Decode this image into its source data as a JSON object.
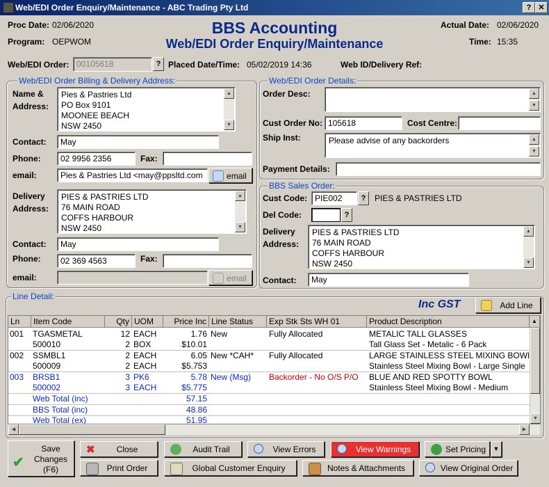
{
  "window": {
    "title": "Web/EDI Order Enquiry/Maintenance - ABC Trading Pty Ltd",
    "help": "?",
    "close": "✕"
  },
  "header": {
    "proc_date_label": "Proc Date:",
    "proc_date": "02/06/2020",
    "program_label": "Program:",
    "program": "OEPWOM",
    "app_title": "BBS Accounting",
    "screen_title": "Web/EDI Order Enquiry/Maintenance",
    "actual_date_label": "Actual Date:",
    "actual_date": "02/06/2020",
    "time_label": "Time:",
    "time": "15:35"
  },
  "order": {
    "label": "Web/EDI Order:",
    "value": "00105618",
    "lookup": "?",
    "placed_label": "Placed Date/Time:",
    "placed": "05/02/2019 14:36",
    "webid_label": "Web ID/Delivery Ref:"
  },
  "billing": {
    "group_title": "Web/EDI Order Billing & Delivery Address:",
    "name_label": "Name &",
    "address_label": "Address:",
    "name_address": [
      "Pies & Pastries Ltd",
      "PO Box 9101",
      "MOONEE BEACH",
      "NSW 2450"
    ],
    "contact_label": "Contact:",
    "contact": "May",
    "phone_label": "Phone:",
    "phone": "02 9956 2356",
    "fax_label": "Fax:",
    "fax": "",
    "email_label": "email:",
    "email": "Pies & Pastries Ltd <may@ppsltd.com",
    "email_btn": "email",
    "delivery_label": "Delivery",
    "delivery_address_label": "Address:",
    "delivery_address": [
      "PIES & PASTRIES LTD",
      "76 MAIN ROAD",
      "COFFS HARBOUR",
      "NSW 2450"
    ],
    "d_contact_label": "Contact:",
    "d_contact": "May",
    "d_phone_label": "Phone:",
    "d_phone": "02 369 4563",
    "d_fax_label": "Fax:",
    "d_fax": "",
    "d_email_label": "email:",
    "d_email": "",
    "d_email_btn": "email"
  },
  "details": {
    "group_title": "Web/EDI Order Details:",
    "desc_label": "Order Desc:",
    "desc": "",
    "cust_order_label": "Cust Order No:",
    "cust_order": "105618",
    "cost_centre_label": "Cost Centre:",
    "cost_centre": "",
    "ship_label": "Ship Inst:",
    "ship": "Please advise of any backorders",
    "payment_label": "Payment Details:",
    "payment": ""
  },
  "sales": {
    "group_title": "BBS Sales Order:",
    "cust_code_label": "Cust Code:",
    "cust_code": "PIE002",
    "cust_lookup": "?",
    "cust_name": "PIES & PASTRIES LTD",
    "del_code_label": "Del Code:",
    "del_code": "",
    "del_lookup": "?",
    "delivery_label": "Delivery",
    "address_label": "Address:",
    "address": [
      "PIES & PASTRIES LTD",
      "76 MAIN ROAD",
      "COFFS HARBOUR",
      "NSW 2450"
    ],
    "contact_label": "Contact:",
    "contact": "May"
  },
  "lines": {
    "group_title": "Line Detail:",
    "inc_gst": "Inc GST",
    "add_line": "Add Line",
    "columns": [
      "Ln",
      "Item Code",
      "Qty",
      "UOM",
      "Price Inc",
      "Line Status",
      "Exp Stk Sts WH 01",
      "Product Description"
    ],
    "rows": [
      {
        "ln": "001",
        "item": "TGASMETAL",
        "qty": "12",
        "uom": "EACH",
        "price": "1.76",
        "status": "New",
        "stock": "Fully Allocated",
        "desc": "METALIC TALL GLASSES",
        "item2": "500010",
        "qty2": "2",
        "uom2": "BOX",
        "price2": "$10.01",
        "desc2": "Tall Glass Set - Metalic - 6 Pack"
      },
      {
        "ln": "002",
        "item": "SSMBL1",
        "qty": "2",
        "uom": "EACH",
        "price": "6.05",
        "status": "New *CAH*",
        "stock": "Fully Allocated",
        "desc": "LARGE STAINLESS STEEL MIXING BOWL",
        "item2": "500009",
        "qty2": "2",
        "uom2": "EACH",
        "price2": "$5.753",
        "desc2": "Stainless Steel Mixing Bowl - Large Single"
      },
      {
        "ln": "003",
        "item": "BRSB1",
        "qty": "3",
        "uom": "PK6",
        "price": "5.78",
        "status": "New (Msg)",
        "stock": "Backorder - No O/S P/O",
        "desc": "BLUE AND RED SPOTTY BOWL",
        "item2": "500002",
        "qty2": "3",
        "uom2": "EACH",
        "price2": "$5.775",
        "desc2": "Stainless Steel Mixing Bowl - Medium"
      }
    ],
    "totals": [
      {
        "label": "Web Total (inc)",
        "value": "57.15"
      },
      {
        "label": "BBS Total (inc)",
        "value": "48.86"
      },
      {
        "label": "Web Total (ex)",
        "value": "51.95"
      }
    ]
  },
  "buttons": {
    "save": [
      "Save",
      "Changes",
      "(F6)"
    ],
    "close": "Close",
    "audit": "Audit Trail",
    "errors": "View Errors",
    "warnings": "View Warnings",
    "pricing": "Set Pricing",
    "print": "Print Order",
    "global": "Global Customer Enquiry",
    "notes": "Notes & Attachments",
    "original": "View Original Order"
  },
  "colors": {
    "title_blue": "#0a2a8a",
    "group_title": "#0a46c8",
    "warning_btn": "#e83030",
    "line_blue": "#0a2ac8",
    "backorder_red": "#d40000"
  }
}
